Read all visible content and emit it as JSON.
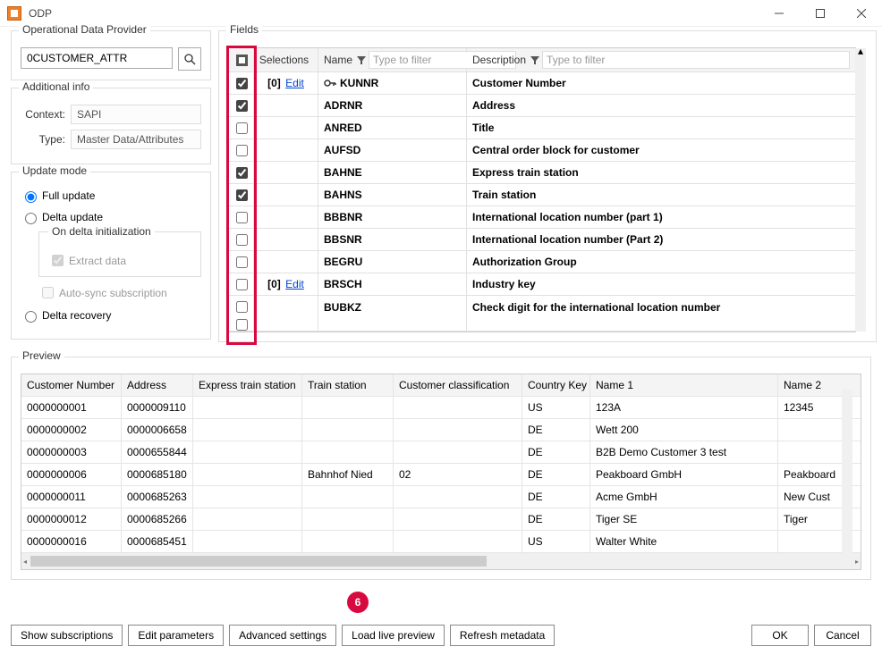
{
  "window": {
    "title": "ODP"
  },
  "odp": {
    "legend": "Operational Data Provider",
    "value": "0CUSTOMER_ATTR"
  },
  "addinfo": {
    "legend": "Additional info",
    "context_label": "Context:",
    "context_value": "SAPI",
    "type_label": "Type:",
    "type_value": "Master Data/Attributes"
  },
  "update": {
    "legend": "Update mode",
    "full": "Full update",
    "delta": "Delta update",
    "on_delta": "On delta initialization",
    "extract": "Extract data",
    "autosync": "Auto-sync subscription",
    "recovery": "Delta recovery"
  },
  "fields": {
    "legend": "Fields",
    "hdr_selections": "Selections",
    "hdr_name": "Name",
    "hdr_desc": "Description",
    "filter_placeholder": "Type to filter",
    "edit_label": "Edit",
    "zero_sel": "[0]",
    "rows": [
      {
        "chk": true,
        "sel": true,
        "key": true,
        "name": "KUNNR",
        "desc": "Customer Number"
      },
      {
        "chk": true,
        "sel": false,
        "key": false,
        "name": "ADRNR",
        "desc": "Address"
      },
      {
        "chk": false,
        "sel": false,
        "key": false,
        "name": "ANRED",
        "desc": "Title"
      },
      {
        "chk": false,
        "sel": false,
        "key": false,
        "name": "AUFSD",
        "desc": "Central order block for customer"
      },
      {
        "chk": true,
        "sel": false,
        "key": false,
        "name": "BAHNE",
        "desc": "Express train station"
      },
      {
        "chk": true,
        "sel": false,
        "key": false,
        "name": "BAHNS",
        "desc": "Train station"
      },
      {
        "chk": false,
        "sel": false,
        "key": false,
        "name": "BBBNR",
        "desc": "International location number  (part 1)"
      },
      {
        "chk": false,
        "sel": false,
        "key": false,
        "name": "BBSNR",
        "desc": "International location number (Part 2)"
      },
      {
        "chk": false,
        "sel": false,
        "key": false,
        "name": "BEGRU",
        "desc": "Authorization Group"
      },
      {
        "chk": false,
        "sel": true,
        "key": false,
        "name": "BRSCH",
        "desc": "Industry key"
      },
      {
        "chk": false,
        "sel": false,
        "key": false,
        "name": "BUBKZ",
        "desc": "Check digit for the international location number"
      }
    ]
  },
  "preview": {
    "legend": "Preview",
    "headers": [
      "Customer Number",
      "Address",
      "Express train station",
      "Train station",
      "Customer classification",
      "Country Key",
      "Name 1",
      "Name 2"
    ],
    "rows": [
      [
        "0000000001",
        "0000009110",
        "",
        "",
        "",
        "US",
        "123A",
        "12345"
      ],
      [
        "0000000002",
        "0000006658",
        "",
        "",
        "",
        "DE",
        "Wett 200",
        ""
      ],
      [
        "0000000003",
        "0000655844",
        "",
        "",
        "",
        "DE",
        "B2B Demo Customer 3 test",
        ""
      ],
      [
        "0000000006",
        "0000685180",
        "",
        "Bahnhof Nied",
        "02",
        "DE",
        "Peakboard GmbH",
        "Peakboard"
      ],
      [
        "0000000011",
        "0000685263",
        "",
        "",
        "",
        "DE",
        "Acme GmbH",
        "New Cust"
      ],
      [
        "0000000012",
        "0000685266",
        "",
        "",
        "",
        "DE",
        "Tiger SE",
        "Tiger"
      ],
      [
        "0000000016",
        "0000685451",
        "",
        "",
        "",
        "US",
        "Walter White",
        ""
      ]
    ]
  },
  "marker": "6",
  "footer": {
    "show_subs": "Show subscriptions",
    "edit_params": "Edit parameters",
    "advanced": "Advanced settings",
    "live_preview": "Load live preview",
    "refresh": "Refresh metadata",
    "ok": "OK",
    "cancel": "Cancel"
  }
}
